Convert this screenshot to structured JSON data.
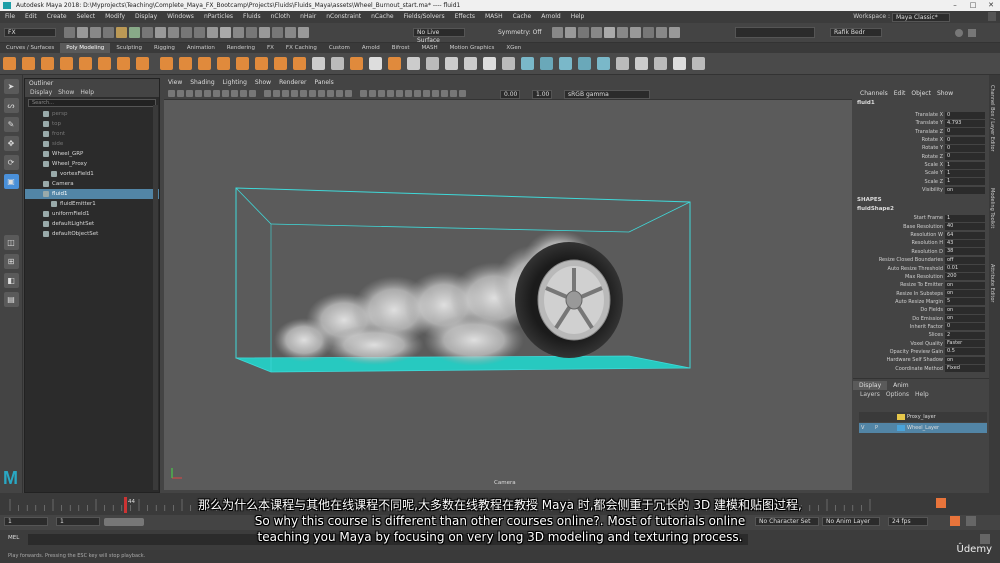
{
  "window": {
    "title": "Autodesk Maya 2018: D:\\Myprojects\\Teaching\\Complete_Maya_FX_Bootcamp\\Projects\\Fluids\\Fluids_Maya\\assets\\Wheel_Burnout_start.ma*   ----   fluid1"
  },
  "menubar": {
    "items": [
      "File",
      "Edit",
      "Create",
      "Select",
      "Modify",
      "Display",
      "Windows",
      "nParticles",
      "Fluids",
      "nCloth",
      "nHair",
      "nConstraint",
      "nCache",
      "Fields/Solvers",
      "Effects",
      "MASH",
      "Cache",
      "Arnold",
      "Help"
    ],
    "workspace_label": "Workspace :",
    "workspace_value": "Maya Classic*"
  },
  "statusline": {
    "menuset": "FX",
    "live_surface": "No Live Surface",
    "symmetry": "Symmetry: Off",
    "user": "Rafik Bedr"
  },
  "shelf": {
    "tabs": [
      "Curves / Surfaces",
      "Poly Modeling",
      "Sculpting",
      "Rigging",
      "Animation",
      "Rendering",
      "FX",
      "FX Caching",
      "Custom",
      "Arnold",
      "Bifrost",
      "MASH",
      "Motion Graphics",
      "XGen"
    ],
    "active_tab": "Poly Modeling"
  },
  "outliner": {
    "title": "Outliner",
    "menus": [
      "Display",
      "Show",
      "Help"
    ],
    "search_placeholder": "Search...",
    "items": [
      {
        "label": "persp",
        "indent": 1,
        "dim": true
      },
      {
        "label": "top",
        "indent": 1,
        "dim": true
      },
      {
        "label": "front",
        "indent": 1,
        "dim": true
      },
      {
        "label": "side",
        "indent": 1,
        "dim": true
      },
      {
        "label": "Wheel_GRP",
        "indent": 1,
        "dim": false
      },
      {
        "label": "Wheel_Proxy",
        "indent": 1,
        "dim": false
      },
      {
        "label": "vortexField1",
        "indent": 2,
        "dim": false
      },
      {
        "label": "Camera",
        "indent": 1,
        "dim": false
      },
      {
        "label": "fluid1",
        "indent": 1,
        "dim": false,
        "selected": true
      },
      {
        "label": "fluidEmitter1",
        "indent": 2,
        "dim": false
      },
      {
        "label": "uniformField1",
        "indent": 1,
        "dim": false
      },
      {
        "label": "defaultLightSet",
        "indent": 1,
        "dim": false
      },
      {
        "label": "defaultObjectSet",
        "indent": 1,
        "dim": false
      }
    ]
  },
  "viewport": {
    "menus": [
      "View",
      "Shading",
      "Lighting",
      "Show",
      "Renderer",
      "Panels"
    ],
    "field_a": "0.00",
    "field_b": "1.00",
    "colorspace": "sRGB gamma",
    "camera_label": "Camera"
  },
  "channelbox": {
    "menus": [
      "Channels",
      "Edit",
      "Object",
      "Show"
    ],
    "node": "fluid1",
    "transform": [
      {
        "label": "Translate X",
        "value": "0"
      },
      {
        "label": "Translate Y",
        "value": "4.793"
      },
      {
        "label": "Translate Z",
        "value": "0"
      },
      {
        "label": "Rotate X",
        "value": "0"
      },
      {
        "label": "Rotate Y",
        "value": "0"
      },
      {
        "label": "Rotate Z",
        "value": "0"
      },
      {
        "label": "Scale X",
        "value": "1"
      },
      {
        "label": "Scale Y",
        "value": "1"
      },
      {
        "label": "Scale Z",
        "value": "1"
      },
      {
        "label": "Visibility",
        "value": "on"
      }
    ],
    "shapes_header": "SHAPES",
    "shape_node": "fluidShape2",
    "shape_attrs": [
      {
        "label": "Start Frame",
        "value": "1"
      },
      {
        "label": "Base Resolution",
        "value": "40"
      },
      {
        "label": "Resolution W",
        "value": "64"
      },
      {
        "label": "Resolution H",
        "value": "43"
      },
      {
        "label": "Resolution D",
        "value": "38"
      },
      {
        "label": "Resize Closed Boundaries",
        "value": "off"
      },
      {
        "label": "Auto Resize Threshold",
        "value": "0.01"
      },
      {
        "label": "Max Resolution",
        "value": "200"
      },
      {
        "label": "Resize To Emitter",
        "value": "on"
      },
      {
        "label": "Resize In Substeps",
        "value": "on"
      },
      {
        "label": "Auto Resize Margin",
        "value": "5"
      },
      {
        "label": "Do Fields",
        "value": "on"
      },
      {
        "label": "Do Emission",
        "value": "on"
      },
      {
        "label": "Inherit Factor",
        "value": "0"
      },
      {
        "label": "Slices",
        "value": "2"
      },
      {
        "label": "Voxel Quality",
        "value": "Faster"
      },
      {
        "label": "Opacity Preview Gain",
        "value": "0.5"
      },
      {
        "label": "Hardware Self Shadow",
        "value": "on"
      },
      {
        "label": "Coordinate Method",
        "value": "Fixed"
      }
    ]
  },
  "layers": {
    "tabs": [
      "Display",
      "Anim"
    ],
    "menus": [
      "Layers",
      "Options",
      "Help"
    ],
    "rows": [
      {
        "name": "Proxy_layer",
        "color": "#e6c74a",
        "v": "",
        "p": "",
        "selected": false
      },
      {
        "name": "Wheel_Layer",
        "color": "#4aa3d9",
        "v": "V",
        "p": "P",
        "selected": true
      }
    ]
  },
  "right_tabs": [
    "Channel Box / Layer Editor",
    "Modeling Toolkit",
    "Attribute Editor"
  ],
  "timeline": {
    "start": "1",
    "start2": "1",
    "end": "120",
    "end_value": "44",
    "character_set": "No Character Set",
    "anim_layer": "No Anim Layer",
    "fps": "24 fps"
  },
  "cmdline": {
    "mode": "MEL"
  },
  "helpline": {
    "text": "Play forwards. Pressing the ESC key will stop playback."
  },
  "subtitles": {
    "line_cn": "那么为什么本课程与其他在线课程不同呢,大多数在线教程在教授 Maya 时,都会侧重于冗长的 3D 建模和贴图过程,",
    "line_en1": "So why this course is different than other courses online?. Most of tutorials online",
    "line_en2": "teaching you Maya by focusing on very long 3D modeling and texturing process."
  },
  "watermark": "Ûdemy",
  "colors": {
    "fluid_box": "#3fd9d9",
    "ground_plane": "#27c9c0",
    "selection": "#5285a6",
    "maya_teal": "#29a8c4",
    "record_button": "#e8743b"
  }
}
